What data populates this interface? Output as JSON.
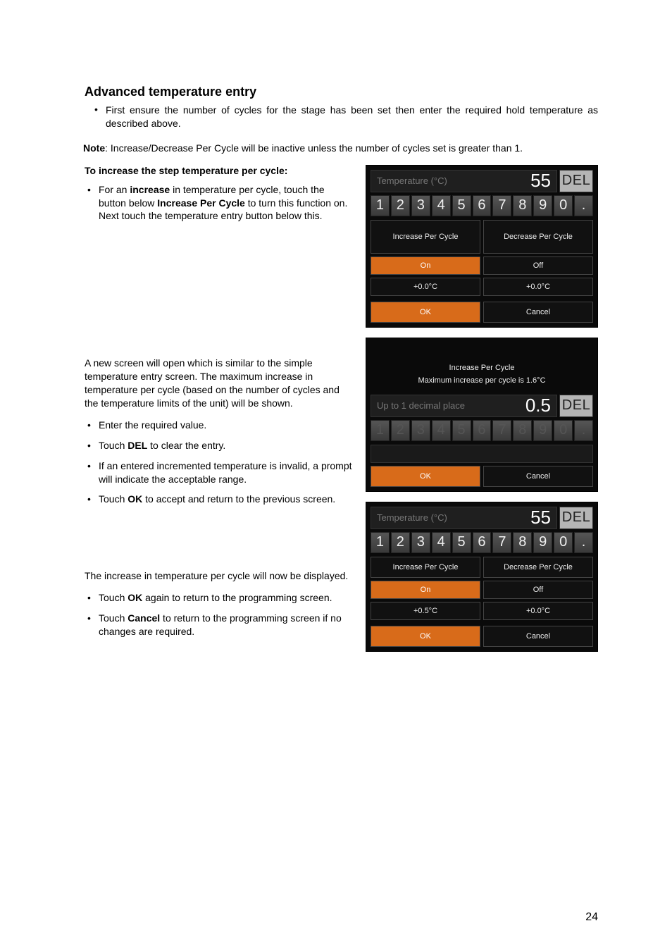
{
  "page_number": "24",
  "heading": "Advanced temperature entry",
  "intro_bullet": "First ensure the number of cycles for the stage has been set then enter the required hold temperature as described above.",
  "note_label": "Note",
  "note_text": ": Increase/Decrease Per Cycle will be inactive unless the number of cycles set is greater than 1.",
  "subhead": "To increase the step temperature per cycle:",
  "bullet1_pre": "For an ",
  "bullet1_b1": "increase",
  "bullet1_mid": " in temperature per cycle, touch the button below ",
  "bullet1_b2": "Increase Per Cycle",
  "bullet1_post": " to turn this function on. Next touch the temperature entry button below this.",
  "para1": "A new screen will open which is similar to the simple temperature entry screen. The maximum increase in temperature per cycle (based on the number of cycles and the temperature limits of the unit) will be shown.",
  "b2_1": "Enter the required value.",
  "b2_2_pre": "Touch ",
  "b2_2_b": "DEL",
  "b2_2_post": " to clear the entry.",
  "b2_3": "If an entered incremented temperature is invalid, a prompt will indicate the acceptable range.",
  "b2_4_pre": "Touch ",
  "b2_4_b": "OK",
  "b2_4_post": " to accept and return to the previous screen.",
  "para2": "The increase in temperature per cycle will now be displayed.",
  "b3_1_pre": "Touch ",
  "b3_1_b": "OK",
  "b3_1_post": " again to return to the programming screen.",
  "b3_2_pre": "Touch ",
  "b3_2_b": "Cancel",
  "b3_2_post": " to return to the programming screen if no changes are required.",
  "keys": [
    "1",
    "2",
    "3",
    "4",
    "5",
    "6",
    "7",
    "8",
    "9",
    "0",
    "."
  ],
  "del": "DEL",
  "panel_a": {
    "label": "Temperature (°C)",
    "value": "55",
    "inc": "Increase Per Cycle",
    "dec": "Decrease Per Cycle",
    "on": "On",
    "off": "Off",
    "inc_val": "+0.0°C",
    "dec_val": "+0.0°C",
    "ok": "OK",
    "cancel": "Cancel"
  },
  "panel_b": {
    "title": "Increase Per Cycle",
    "sub": "Maximum increase per cycle is 1.6°C",
    "label": "Up to 1 decimal place",
    "value": "0.5",
    "ok": "OK",
    "cancel": "Cancel"
  },
  "panel_c": {
    "label": "Temperature (°C)",
    "value": "55",
    "inc": "Increase Per Cycle",
    "dec": "Decrease Per Cycle",
    "on": "On",
    "off": "Off",
    "inc_val": "+0.5°C",
    "dec_val": "+0.0°C",
    "ok": "OK",
    "cancel": "Cancel"
  }
}
